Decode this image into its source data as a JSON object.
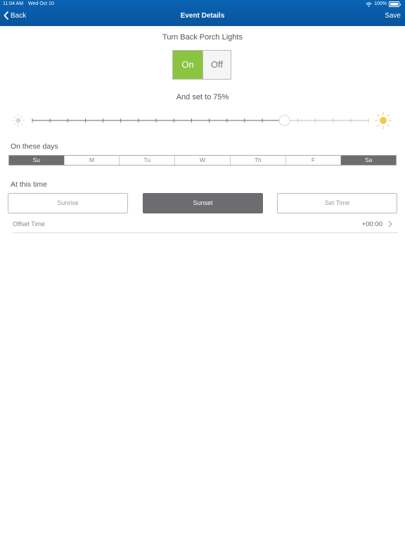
{
  "status_bar": {
    "time": "11:04 AM",
    "date": "Wed Oct 10",
    "battery": "100%"
  },
  "nav": {
    "back_label": "Back",
    "title": "Event Details",
    "save_label": "Save"
  },
  "device_heading": "Turn Back Porch Lights",
  "toggle": {
    "on_label": "On",
    "off_label": "Off",
    "selected": "On"
  },
  "level_heading": "And set to 75%",
  "brightness": {
    "value_percent": 75
  },
  "days_section": {
    "label": "On these days",
    "days": [
      {
        "label": "Su",
        "selected": true
      },
      {
        "label": "M",
        "selected": false
      },
      {
        "label": "Tu",
        "selected": false
      },
      {
        "label": "W",
        "selected": false
      },
      {
        "label": "Th",
        "selected": false
      },
      {
        "label": "F",
        "selected": false
      },
      {
        "label": "Sa",
        "selected": true
      }
    ]
  },
  "time_section": {
    "label": "At this time",
    "options": [
      {
        "label": "Sunrise",
        "selected": false
      },
      {
        "label": "Sunset",
        "selected": true
      },
      {
        "label": "Set Time",
        "selected": false
      }
    ]
  },
  "offset": {
    "label": "Offset Time",
    "value": "+00:00"
  },
  "colors": {
    "nav_blue": "#0a5fae",
    "accent_green": "#8bc441",
    "selected_gray": "#6d6d6f",
    "sun_yellow": "#f2c94c"
  }
}
